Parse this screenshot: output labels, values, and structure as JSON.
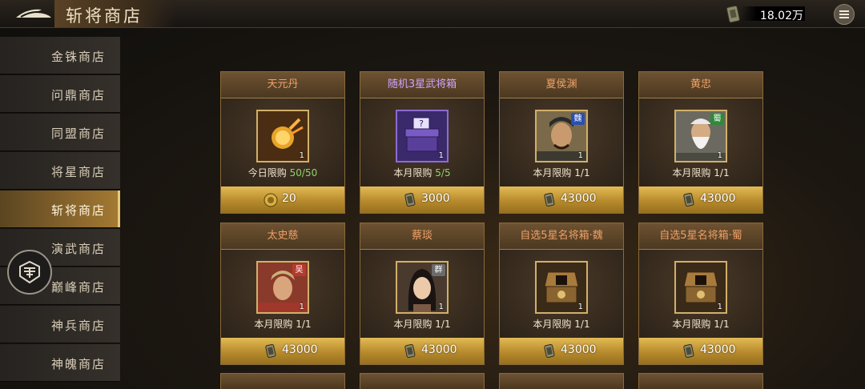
{
  "header": {
    "title": "斩将商店",
    "currency_amount": "18.02万"
  },
  "icons": {
    "back": "back-arrow-icon",
    "currency": "jade-token-icon",
    "menu": "menu-icon",
    "float": "helmet-icon"
  },
  "sidebar": {
    "items": [
      {
        "label": "金铢商店"
      },
      {
        "label": "问鼎商店"
      },
      {
        "label": "同盟商店"
      },
      {
        "label": "将星商店"
      },
      {
        "label": "斩将商店",
        "active": true
      },
      {
        "label": "演武商店"
      },
      {
        "label": "巅峰商店"
      },
      {
        "label": "神兵商店"
      },
      {
        "label": "神魄商店"
      }
    ]
  },
  "shop": {
    "items": [
      {
        "name": "天元丹",
        "count": "1",
        "limit_text": "今日限购",
        "limit_value": "50/50",
        "price": "20",
        "price_icon": "gold-coin-icon"
      },
      {
        "name": "随机3星武将箱",
        "count": "1",
        "limit_text": "本月限购",
        "limit_value": "5/5",
        "price": "3000",
        "price_icon": "jade-token-icon"
      },
      {
        "name": "夏侯渊",
        "count": "1",
        "faction": "魏",
        "limit_text": "本月限购",
        "limit_value": "1/1",
        "price": "43000",
        "price_icon": "jade-token-icon"
      },
      {
        "name": "黄忠",
        "count": "1",
        "faction": "蜀",
        "limit_text": "本月限购",
        "limit_value": "1/1",
        "price": "43000",
        "price_icon": "jade-token-icon"
      },
      {
        "name": "太史慈",
        "count": "1",
        "faction": "吴",
        "limit_text": "本月限购",
        "limit_value": "1/1",
        "price": "43000",
        "price_icon": "jade-token-icon"
      },
      {
        "name": "蔡琰",
        "count": "1",
        "faction": "群",
        "limit_text": "本月限购",
        "limit_value": "1/1",
        "price": "43000",
        "price_icon": "jade-token-icon"
      },
      {
        "name": "自选5星名将箱·魏",
        "count": "1",
        "limit_text": "本月限购",
        "limit_value": "1/1",
        "price": "43000",
        "price_icon": "jade-token-icon"
      },
      {
        "name": "自选5星名将箱·蜀",
        "count": "1",
        "limit_text": "本月限购",
        "limit_value": "1/1",
        "price": "43000",
        "price_icon": "jade-token-icon"
      }
    ]
  },
  "colors": {
    "accent_gold": "#e3bb55",
    "name_orange": "#eea168",
    "name_purple": "#cfa3ff",
    "limit_green": "#8fd36a",
    "wei": "#2b4fb0",
    "shu": "#2f8a3a",
    "wu": "#b83a2c",
    "qun": "#6b6b6b"
  }
}
